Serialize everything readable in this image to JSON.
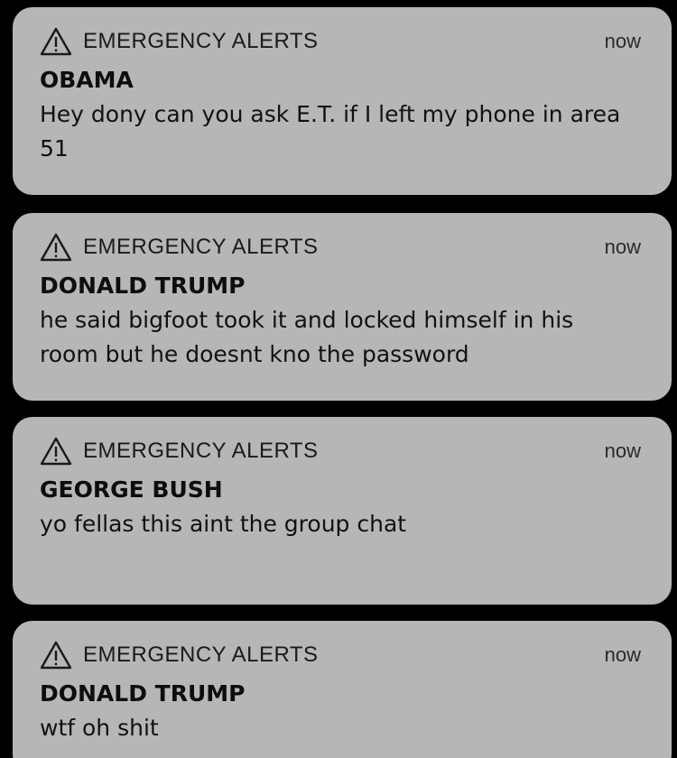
{
  "notifications": [
    {
      "app": "EMERGENCY ALERTS",
      "time": "now",
      "icon": "warning-icon",
      "sender": "OBAMA",
      "message": "Hey dony can you ask E.T. if I left my phone in area 51"
    },
    {
      "app": "EMERGENCY ALERTS",
      "time": "now",
      "icon": "warning-icon",
      "sender": "DONALD TRUMP",
      "message": "he said bigfoot took it and locked himself in his room but he doesnt kno the password"
    },
    {
      "app": "EMERGENCY ALERTS",
      "time": "now",
      "icon": "warning-icon",
      "sender": "GEORGE BUSH",
      "message": "yo fellas this aint the group chat"
    },
    {
      "app": "EMERGENCY ALERTS",
      "time": "now",
      "icon": "warning-icon",
      "sender": "DONALD TRUMP",
      "message": "wtf oh shit"
    }
  ],
  "colors": {
    "background": "#000000",
    "card": "#b6b6b6",
    "text": "#111111"
  }
}
